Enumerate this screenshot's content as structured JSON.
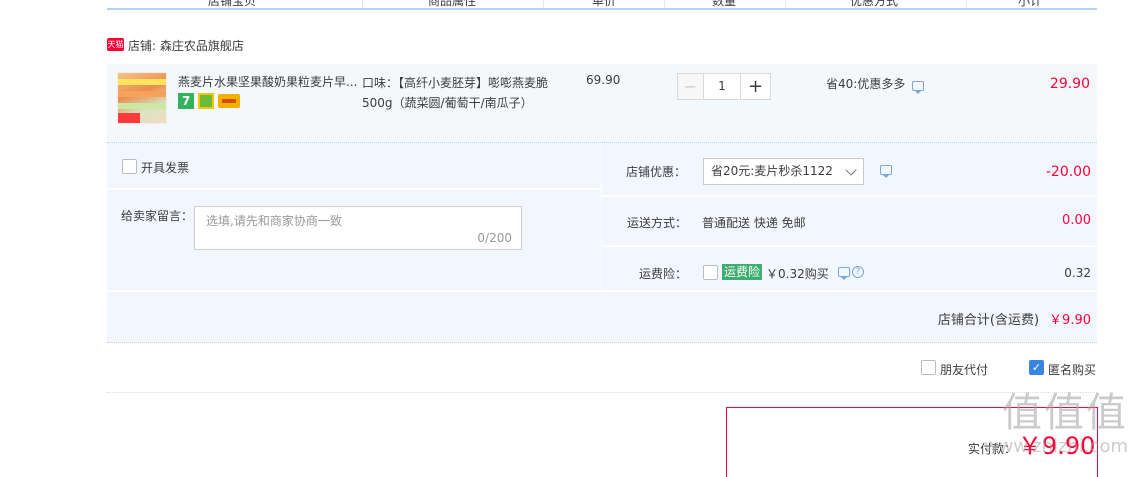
{
  "columns": [
    "店铺宝贝",
    "商品属性",
    "单价",
    "数量",
    "优惠方式",
    "小计"
  ],
  "shop": {
    "badge": "天猫",
    "label": "店铺: 森庄农品旗舰店"
  },
  "item": {
    "title": "燕麦片水果坚果酸奶果粒麦片早...",
    "badge_7": "7",
    "sku": "口味：【高纤小麦胚芽】嘭嘭燕麦脆500g（蔬菜圆/葡萄干/南瓜子）",
    "price": "69.90",
    "quantity": "1",
    "minus": "−",
    "plus": "+",
    "promo": "省40:优惠多多",
    "subtotal": "29.90"
  },
  "options": {
    "invoice_label": "开具发票",
    "message_label": "给卖家留言：",
    "message_placeholder": "选填,请先和商家协商一致",
    "message_count": "0/200",
    "shop_coupon_label": "店铺优惠：",
    "shop_coupon_value": "省20元:麦片秒杀1122",
    "shop_coupon_amount": "-20.00",
    "shipping_label": "运送方式：",
    "shipping_value": "普通配送 快递 免邮",
    "shipping_amount": "0.00",
    "insurance_label": "运费险：",
    "insurance_tag": "运费险",
    "insurance_text": "￥0.32购买",
    "insurance_amount": "0.32",
    "help_glyph": "?"
  },
  "totals": {
    "shop_total_label": "店铺合计(含运费)",
    "shop_total_amount": "￥9.90"
  },
  "checkout": {
    "friend_pay_label": "朋友代付",
    "anonymous_label": "匿名购买",
    "anonymous_checked": true,
    "check_glyph": "✓",
    "pay_label": "实付款：",
    "pay_amount": "￥9.90"
  },
  "watermark": {
    "logo": "值值值",
    "url": "www.zhizhi.com"
  },
  "colors": {
    "accent_red": "#ff0036",
    "row_bg": "#f2f7ff",
    "header_line": "#b2d1ff",
    "checkbox_blue": "#3a85e4",
    "insurance_green": "#3dae6e"
  }
}
